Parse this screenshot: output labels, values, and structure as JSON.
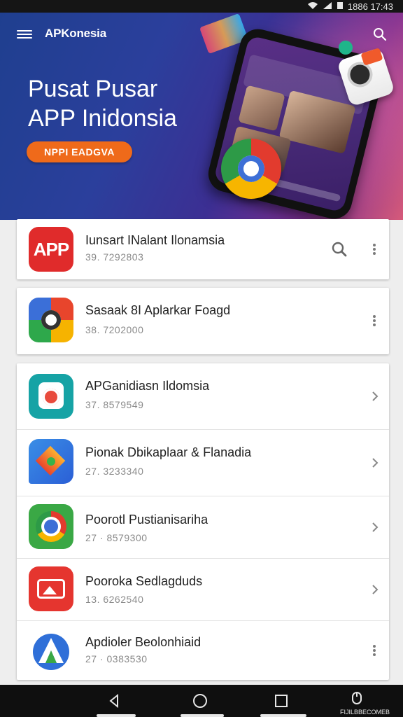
{
  "status_bar": {
    "time": "1886 17:43"
  },
  "header": {
    "brand": "APKonesia"
  },
  "hero": {
    "title_line1": "Pusat Pusar",
    "title_line2": "APP Inidonsia",
    "button_label": "NPPI EADGVA"
  },
  "apps": [
    {
      "name": "Iunsart INalant Ilonamsia",
      "sub": "39. 7292803",
      "icon": "app-red-icon",
      "action": "search-and-more"
    },
    {
      "name": "Sasaak 8I Aplarkar Foagd",
      "sub": "38. 7202000",
      "icon": "google-photos-icon",
      "action": "more"
    },
    {
      "name": "APGanidiasn Ildomsia",
      "sub": "37. 8579549",
      "icon": "camera-app-icon",
      "action": "chevron"
    },
    {
      "name": "Pionak Dbikaplaar & Flanadia",
      "sub": "27. 3233340",
      "icon": "rocket-app-icon",
      "action": "chevron"
    },
    {
      "name": "Poorotl Pustianisariha",
      "sub": "27 · 8579300",
      "icon": "chrome-icon",
      "action": "chevron"
    },
    {
      "name": "Pooroka Sedlagduds",
      "sub": "13. 6262540",
      "icon": "red-video-icon",
      "action": "chevron"
    },
    {
      "name": "Apdioler Beolonhiaid",
      "sub": "27 · 0383530",
      "icon": "arrow-a-icon",
      "action": "more"
    }
  ],
  "navbar": {
    "label": "FIJILBBECOMEB"
  },
  "colors": {
    "accent": "#ef6a1a",
    "hero_start": "#1f3f8f",
    "hero_end": "#d65a7a"
  }
}
